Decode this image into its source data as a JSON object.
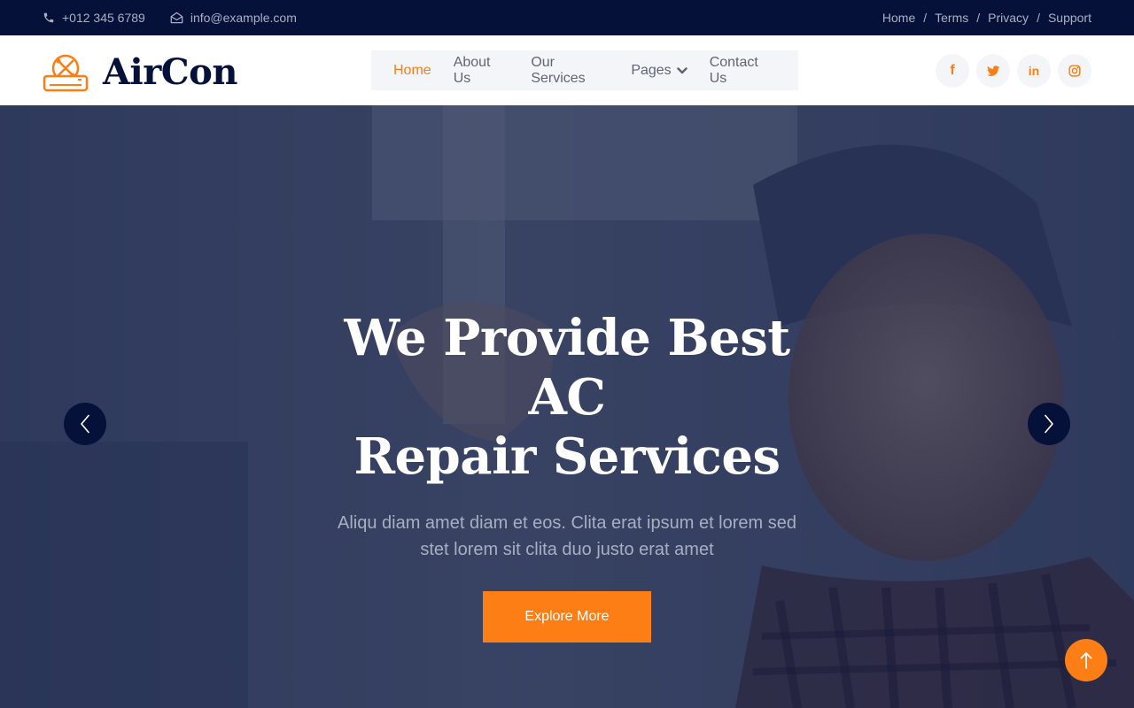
{
  "topbar": {
    "phone": "+012 345 6789",
    "email": "info@example.com",
    "links": [
      "Home",
      "Terms",
      "Privacy",
      "Support"
    ],
    "separator": "/"
  },
  "brand": {
    "name": "AirCon"
  },
  "nav": {
    "items": [
      {
        "label": "Home",
        "active": true
      },
      {
        "label": "About Us"
      },
      {
        "label": "Our Services"
      },
      {
        "label": "Pages",
        "dropdown": true
      },
      {
        "label": "Contact Us"
      }
    ]
  },
  "socials": {
    "icons": [
      "facebook-icon",
      "twitter-icon",
      "linkedin-icon",
      "instagram-icon"
    ],
    "facebook_glyph": "f",
    "linkedin_glyph": "in"
  },
  "hero": {
    "title_line1": "We Provide Best AC",
    "title_line2": "Repair Services",
    "subtitle": "Aliqu diam amet diam et eos. Clita erat ipsum et lorem sed stet lorem sit clita duo justo erat amet",
    "button_label": "Explore More"
  },
  "colors": {
    "primary": "#fd7e14",
    "dark": "#061139",
    "light": "#f3f5f9"
  }
}
